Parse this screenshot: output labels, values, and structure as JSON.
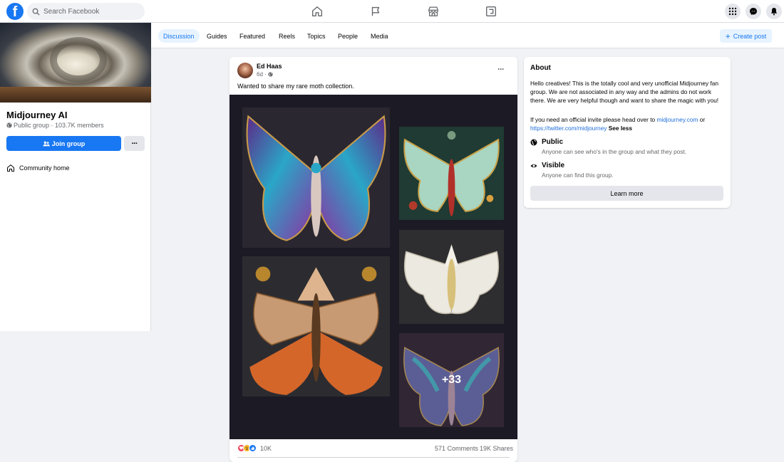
{
  "header": {
    "logo": "f",
    "search_placeholder": "Search Facebook",
    "nav_icons": [
      "home-icon",
      "pages-flag-icon",
      "marketplace-icon",
      "gaming-icon"
    ],
    "right_icons": [
      "menu-grid-icon",
      "messenger-icon",
      "notifications-bell-icon"
    ]
  },
  "group": {
    "name": "Midjourney AI",
    "privacy": "Public group",
    "members": "103.7K members",
    "join_label": "Join group",
    "more_label": "···",
    "community_home": "Community home"
  },
  "tabs": [
    {
      "label": "Discussion",
      "active": true
    },
    {
      "label": "Guides"
    },
    {
      "label": "Featured"
    },
    {
      "label": "Reels"
    },
    {
      "label": "Topics"
    },
    {
      "label": "People"
    },
    {
      "label": "Media"
    }
  ],
  "create_post": "Create post",
  "post": {
    "author": "Ed Haas",
    "time": "6d ·",
    "text": "Wanted to share my rare moth collection.",
    "more_photos": "+33",
    "reaction_count": "10K",
    "comments": "571 Comments",
    "shares": "19K Shares",
    "more_label": "···"
  },
  "about": {
    "title": "About",
    "description": "Hello creatives! This is the totally cool and very unofficial Midjourney fan group. We are not associated in any way and the admins do not work there. We are very helpful though and want to share the magic with you!",
    "invite_prefix": "If you need an official invite please head over to",
    "invite_link1": "midjourney.com",
    "invite_or": "or",
    "invite_link2": "https://twitter.com/midjourney",
    "see_less": "See less",
    "public_title": "Public",
    "public_desc": "Anyone can see who's in the group and what they post.",
    "visible_title": "Visible",
    "visible_desc": "Anyone can find this group.",
    "learn_more": "Learn more"
  },
  "colors": {
    "brand": "#1877f2",
    "background": "#f0f2f5",
    "link": "#216fdb"
  }
}
